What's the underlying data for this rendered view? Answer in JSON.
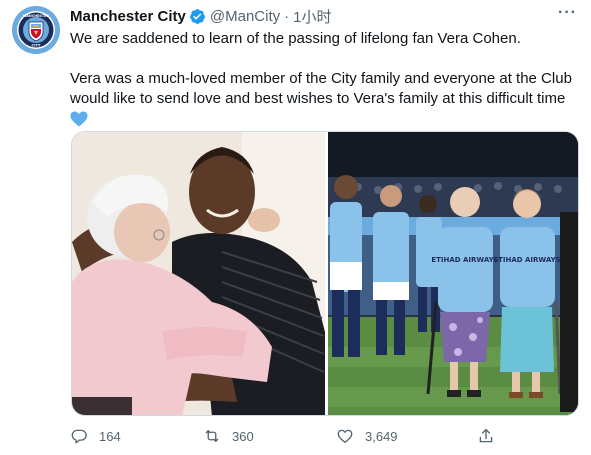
{
  "tweet": {
    "display_name": "Manchester City",
    "handle": "@ManCity",
    "separator": "·",
    "time": "1小时",
    "more": "···",
    "text_paragraph_1": "We are saddened to learn of the passing of lifelong fan Vera Cohen.",
    "text_paragraph_2": "Vera was a much-loved member of the City family and everyone at the Club would like to send love and best wishes to Vera's family at this difficult time",
    "emoji": "blue-heart",
    "avatar_label": "MANCHESTER CITY",
    "shirt_sponsor": "ETIHAD AIRWAYS"
  },
  "actions": {
    "replies": "164",
    "retweets": "360",
    "likes": "3,649"
  },
  "colors": {
    "brand_sky_blue": "#6cabdd",
    "verified_blue": "#1d9bf0",
    "muted_text": "#536471",
    "heart_blue": "#5dadec"
  }
}
